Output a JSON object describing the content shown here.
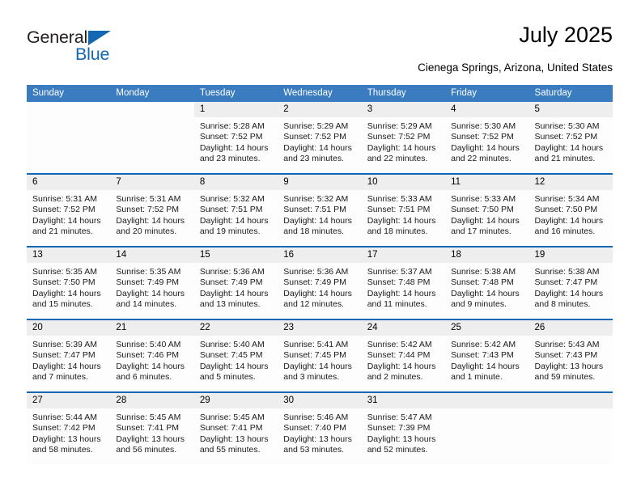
{
  "brand": {
    "name_part1": "General",
    "name_part2": "Blue",
    "accent_color": "#1268b3"
  },
  "header": {
    "title": "July 2025",
    "subtitle": "Cienega Springs, Arizona, United States"
  },
  "calendar": {
    "header_color": "#3a7cbf",
    "weekday_headers": [
      "Sunday",
      "Monday",
      "Tuesday",
      "Wednesday",
      "Thursday",
      "Friday",
      "Saturday"
    ],
    "weeks": [
      [
        {
          "day": "",
          "blank": true
        },
        {
          "day": "",
          "blank": true
        },
        {
          "day": "1",
          "sunrise": "Sunrise: 5:28 AM",
          "sunset": "Sunset: 7:52 PM",
          "daylight_line1": "Daylight: 14 hours",
          "daylight_line2": "and 23 minutes."
        },
        {
          "day": "2",
          "sunrise": "Sunrise: 5:29 AM",
          "sunset": "Sunset: 7:52 PM",
          "daylight_line1": "Daylight: 14 hours",
          "daylight_line2": "and 23 minutes."
        },
        {
          "day": "3",
          "sunrise": "Sunrise: 5:29 AM",
          "sunset": "Sunset: 7:52 PM",
          "daylight_line1": "Daylight: 14 hours",
          "daylight_line2": "and 22 minutes."
        },
        {
          "day": "4",
          "sunrise": "Sunrise: 5:30 AM",
          "sunset": "Sunset: 7:52 PM",
          "daylight_line1": "Daylight: 14 hours",
          "daylight_line2": "and 22 minutes."
        },
        {
          "day": "5",
          "sunrise": "Sunrise: 5:30 AM",
          "sunset": "Sunset: 7:52 PM",
          "daylight_line1": "Daylight: 14 hours",
          "daylight_line2": "and 21 minutes."
        }
      ],
      [
        {
          "day": "6",
          "sunrise": "Sunrise: 5:31 AM",
          "sunset": "Sunset: 7:52 PM",
          "daylight_line1": "Daylight: 14 hours",
          "daylight_line2": "and 21 minutes."
        },
        {
          "day": "7",
          "sunrise": "Sunrise: 5:31 AM",
          "sunset": "Sunset: 7:52 PM",
          "daylight_line1": "Daylight: 14 hours",
          "daylight_line2": "and 20 minutes."
        },
        {
          "day": "8",
          "sunrise": "Sunrise: 5:32 AM",
          "sunset": "Sunset: 7:51 PM",
          "daylight_line1": "Daylight: 14 hours",
          "daylight_line2": "and 19 minutes."
        },
        {
          "day": "9",
          "sunrise": "Sunrise: 5:32 AM",
          "sunset": "Sunset: 7:51 PM",
          "daylight_line1": "Daylight: 14 hours",
          "daylight_line2": "and 18 minutes."
        },
        {
          "day": "10",
          "sunrise": "Sunrise: 5:33 AM",
          "sunset": "Sunset: 7:51 PM",
          "daylight_line1": "Daylight: 14 hours",
          "daylight_line2": "and 18 minutes."
        },
        {
          "day": "11",
          "sunrise": "Sunrise: 5:33 AM",
          "sunset": "Sunset: 7:50 PM",
          "daylight_line1": "Daylight: 14 hours",
          "daylight_line2": "and 17 minutes."
        },
        {
          "day": "12",
          "sunrise": "Sunrise: 5:34 AM",
          "sunset": "Sunset: 7:50 PM",
          "daylight_line1": "Daylight: 14 hours",
          "daylight_line2": "and 16 minutes."
        }
      ],
      [
        {
          "day": "13",
          "sunrise": "Sunrise: 5:35 AM",
          "sunset": "Sunset: 7:50 PM",
          "daylight_line1": "Daylight: 14 hours",
          "daylight_line2": "and 15 minutes."
        },
        {
          "day": "14",
          "sunrise": "Sunrise: 5:35 AM",
          "sunset": "Sunset: 7:49 PM",
          "daylight_line1": "Daylight: 14 hours",
          "daylight_line2": "and 14 minutes."
        },
        {
          "day": "15",
          "sunrise": "Sunrise: 5:36 AM",
          "sunset": "Sunset: 7:49 PM",
          "daylight_line1": "Daylight: 14 hours",
          "daylight_line2": "and 13 minutes."
        },
        {
          "day": "16",
          "sunrise": "Sunrise: 5:36 AM",
          "sunset": "Sunset: 7:49 PM",
          "daylight_line1": "Daylight: 14 hours",
          "daylight_line2": "and 12 minutes."
        },
        {
          "day": "17",
          "sunrise": "Sunrise: 5:37 AM",
          "sunset": "Sunset: 7:48 PM",
          "daylight_line1": "Daylight: 14 hours",
          "daylight_line2": "and 11 minutes."
        },
        {
          "day": "18",
          "sunrise": "Sunrise: 5:38 AM",
          "sunset": "Sunset: 7:48 PM",
          "daylight_line1": "Daylight: 14 hours",
          "daylight_line2": "and 9 minutes."
        },
        {
          "day": "19",
          "sunrise": "Sunrise: 5:38 AM",
          "sunset": "Sunset: 7:47 PM",
          "daylight_line1": "Daylight: 14 hours",
          "daylight_line2": "and 8 minutes."
        }
      ],
      [
        {
          "day": "20",
          "sunrise": "Sunrise: 5:39 AM",
          "sunset": "Sunset: 7:47 PM",
          "daylight_line1": "Daylight: 14 hours",
          "daylight_line2": "and 7 minutes."
        },
        {
          "day": "21",
          "sunrise": "Sunrise: 5:40 AM",
          "sunset": "Sunset: 7:46 PM",
          "daylight_line1": "Daylight: 14 hours",
          "daylight_line2": "and 6 minutes."
        },
        {
          "day": "22",
          "sunrise": "Sunrise: 5:40 AM",
          "sunset": "Sunset: 7:45 PM",
          "daylight_line1": "Daylight: 14 hours",
          "daylight_line2": "and 5 minutes."
        },
        {
          "day": "23",
          "sunrise": "Sunrise: 5:41 AM",
          "sunset": "Sunset: 7:45 PM",
          "daylight_line1": "Daylight: 14 hours",
          "daylight_line2": "and 3 minutes."
        },
        {
          "day": "24",
          "sunrise": "Sunrise: 5:42 AM",
          "sunset": "Sunset: 7:44 PM",
          "daylight_line1": "Daylight: 14 hours",
          "daylight_line2": "and 2 minutes."
        },
        {
          "day": "25",
          "sunrise": "Sunrise: 5:42 AM",
          "sunset": "Sunset: 7:43 PM",
          "daylight_line1": "Daylight: 14 hours",
          "daylight_line2": "and 1 minute."
        },
        {
          "day": "26",
          "sunrise": "Sunrise: 5:43 AM",
          "sunset": "Sunset: 7:43 PM",
          "daylight_line1": "Daylight: 13 hours",
          "daylight_line2": "and 59 minutes."
        }
      ],
      [
        {
          "day": "27",
          "sunrise": "Sunrise: 5:44 AM",
          "sunset": "Sunset: 7:42 PM",
          "daylight_line1": "Daylight: 13 hours",
          "daylight_line2": "and 58 minutes."
        },
        {
          "day": "28",
          "sunrise": "Sunrise: 5:45 AM",
          "sunset": "Sunset: 7:41 PM",
          "daylight_line1": "Daylight: 13 hours",
          "daylight_line2": "and 56 minutes."
        },
        {
          "day": "29",
          "sunrise": "Sunrise: 5:45 AM",
          "sunset": "Sunset: 7:41 PM",
          "daylight_line1": "Daylight: 13 hours",
          "daylight_line2": "and 55 minutes."
        },
        {
          "day": "30",
          "sunrise": "Sunrise: 5:46 AM",
          "sunset": "Sunset: 7:40 PM",
          "daylight_line1": "Daylight: 13 hours",
          "daylight_line2": "and 53 minutes."
        },
        {
          "day": "31",
          "sunrise": "Sunrise: 5:47 AM",
          "sunset": "Sunset: 7:39 PM",
          "daylight_line1": "Daylight: 13 hours",
          "daylight_line2": "and 52 minutes."
        },
        {
          "day": "",
          "empty": true
        },
        {
          "day": "",
          "empty": true
        }
      ]
    ]
  }
}
